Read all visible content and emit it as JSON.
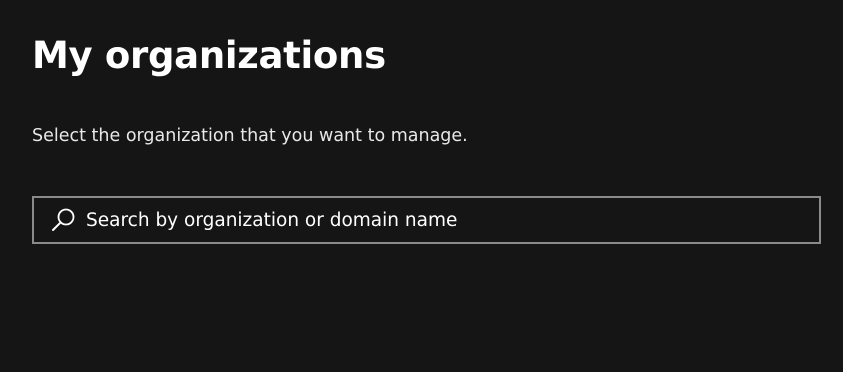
{
  "page": {
    "title": "My organizations",
    "subtitle": "Select the organization that you want to manage."
  },
  "search": {
    "placeholder": "Search by organization or domain name",
    "value": "",
    "icon": "search-icon"
  },
  "colors": {
    "background": "#151515",
    "text": "#ffffff",
    "input_border": "#8a8a8a"
  }
}
